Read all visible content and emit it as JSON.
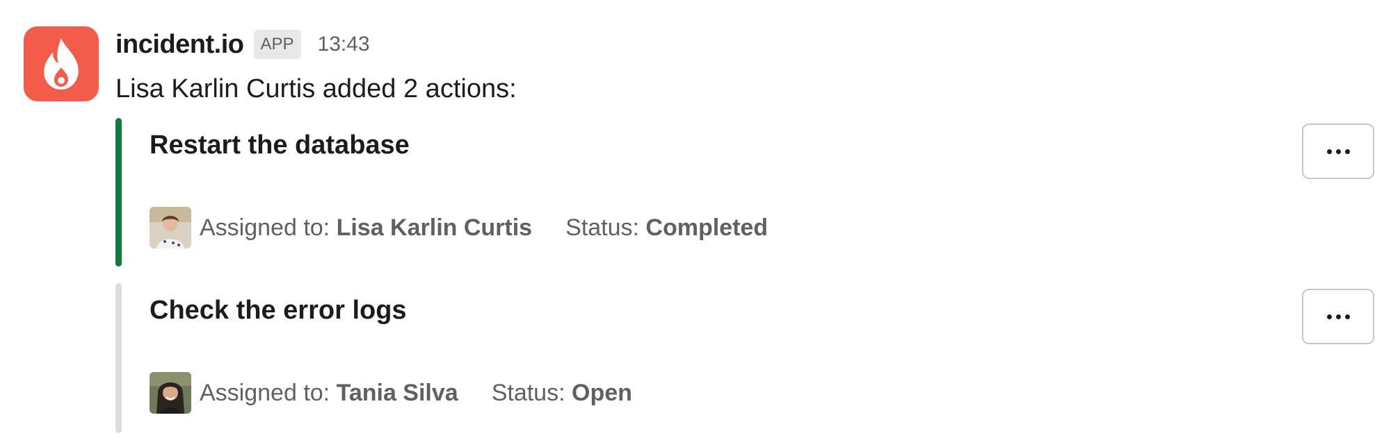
{
  "app": {
    "name": "incident.io",
    "badge": "APP",
    "timestamp": "13:43",
    "icon": "flame-icon",
    "brand_color": "#f25c4b"
  },
  "message": {
    "intro": "Lisa Karlin Curtis added 2 actions:"
  },
  "actions": [
    {
      "title": "Restart the database",
      "assigned_label": "Assigned to:",
      "assignee": "Lisa Karlin Curtis",
      "status_label": "Status:",
      "status": "Completed",
      "bar_color": "#0d7d3e",
      "menu_icon": "more-horizontal-icon"
    },
    {
      "title": "Check the error logs",
      "assigned_label": "Assigned to:",
      "assignee": "Tania Silva",
      "status_label": "Status:",
      "status": "Open",
      "bar_color": "#dddddd",
      "menu_icon": "more-horizontal-icon"
    }
  ]
}
